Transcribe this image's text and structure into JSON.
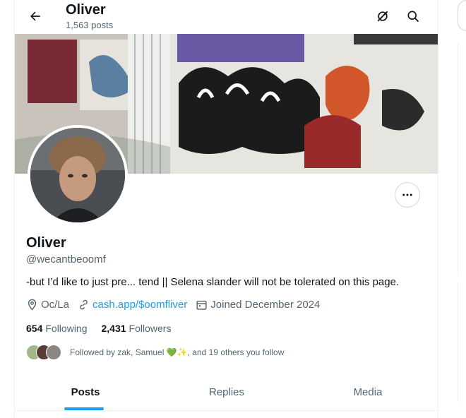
{
  "header": {
    "title": "Oliver",
    "subtitle": "1,563 posts",
    "icons": [
      "back-arrow-icon",
      "grok-icon",
      "search-icon"
    ]
  },
  "profile": {
    "name": "Oliver",
    "handle": "@wecantbeoomf",
    "bio": "-but I’d like to just pre... tend || Selena slander will not be tolerated on this page.",
    "location": "Oc/La",
    "link": "cash.app/$oomfliver",
    "joined": "Joined December 2024",
    "following_count": "654",
    "following_label": "Following",
    "followers_count": "2,431",
    "followers_label": "Followers",
    "followed_by": "Followed by zak, Samuel 💚✨, and 19 others you follow"
  },
  "tabs": [
    {
      "label": "Posts",
      "active": true
    },
    {
      "label": "Replies",
      "active": false
    },
    {
      "label": "Media",
      "active": false
    }
  ],
  "colors": {
    "accent": "#1d9bf0",
    "text": "#0f1419",
    "muted": "#536471",
    "border": "#eff3f4"
  }
}
